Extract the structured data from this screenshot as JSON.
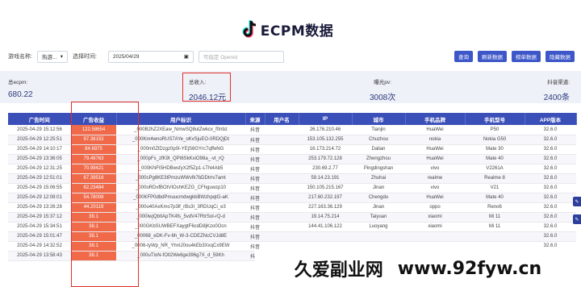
{
  "app": {
    "title": "ECPM数据"
  },
  "filters": {
    "game_label": "游戏名称:",
    "game_value": "热游...",
    "date_label": "选择时间:",
    "date_value": "2025/04/29",
    "openid_placeholder": "可指定 Openid"
  },
  "buttons": [
    "查询",
    "刷新数据",
    "榜单数据",
    "隐藏数据"
  ],
  "stats": [
    {
      "label": "总ecpm:",
      "value": "680.22"
    },
    {
      "label": "总收入:",
      "value": "2046.12元"
    },
    {
      "label": "曝光pv:",
      "value": "3008次"
    },
    {
      "label": "抖音渠道:",
      "value": "2400条"
    }
  ],
  "table": {
    "headers": [
      "广告时间",
      "广告收益",
      "用户标识",
      "来源",
      "用户名",
      "IP",
      "城市",
      "手机品牌",
      "手机型号",
      "APP版本"
    ],
    "rows": [
      [
        "2025-04-29 15:12:56",
        "122.58654",
        "_000B2hZ2XEaw_NmwSQ8utZwkcx_f0nbz",
        "抖音",
        "",
        "26.176.210.46",
        "Tianjin",
        "HuaWei",
        "P50",
        "32.6.0"
      ],
      [
        "2025-04-29 12:25:51",
        "97.38153",
        "_000Km4wnoRUS7AYe_oKvSjuEO-0RDQjDt",
        "抖音",
        "",
        "153.105.132.255",
        "Chuzhou",
        "nokia",
        "Nokia G50",
        "32.6.0"
      ],
      [
        "2025-04-29 14:10:17",
        "84.6975",
        "_000m0ZlDzgz0p0I-YEjS8GYrc7qffeNG",
        "抖音",
        "",
        "16.173.214.72",
        "Dalian",
        "HuaWei",
        "Mate 30",
        "32.6.0"
      ],
      [
        "2025-04-29 13:36:05",
        "79.49763",
        "_000pFs_zfK9I_QPt6SkKxiO98a_-vt_rQ",
        "抖音",
        "",
        "253.179.72.128",
        "Zhengzhou",
        "HuaWei",
        "Mate 40",
        "32.6.0"
      ],
      [
        "2025-04-29 12:31:25",
        "70.99421",
        "_000KNFt5HDBwsfyX2f5Zp1-LTN4Ab5",
        "抖音",
        "",
        "230.69.2.77",
        "Pingdingshan",
        "vivo",
        "V2261A",
        "32.6.0"
      ],
      [
        "2025-04-29 12:51:01",
        "67.39516",
        "_000cPg6KE3tPmzuWWvfk7bDDtrrv7amt",
        "抖音",
        "",
        "59.14.23.191",
        "Zhuhai",
        "realme",
        "Realme 8",
        "32.6.0"
      ],
      [
        "2025-04-29 15:06:55",
        "62.23484",
        "_000oRDvfBOtVIOshKEZG_CFhguwzp10",
        "抖音",
        "",
        "150.105.215.167",
        "Jinan",
        "vivo",
        "V21",
        "32.6.0"
      ],
      [
        "2025-04-29 12:08:01",
        "54.78008",
        "_000KFP0dbdPmuucmdwgkbBWzhpqtG-aK",
        "抖音",
        "",
        "217.60.232.197",
        "Chengdu",
        "HuaWei",
        "Mate 40",
        "32.6.0"
      ],
      [
        "2025-04-29 13:26:28",
        "44.20119",
        "_000o40AxKmo7p3lf_rBs3I_3RDUqCi_e3",
        "抖音",
        "",
        "227.163.36.129",
        "Jinan",
        "oppo",
        "Reno6",
        "32.6.0"
      ],
      [
        "2025-04-29 15:37:12",
        "38.1",
        "_000IwjQbtIApTK4fs_5vdV47RtrSot-rQ-d",
        "抖音",
        "",
        "19.14.75.214",
        "Taiyuan",
        "xiaomi",
        "Mi 11",
        "32.6.0"
      ],
      [
        "2025-04-29 15:34:51",
        "38.1",
        "_000GKbSUWBEFXaygtF6cdD8jKzo0Ocn",
        "抖音",
        "",
        "144.41.106.122",
        "Luoyang",
        "xiaomi",
        "Mi 11",
        "32.6.0"
      ],
      [
        "2025-04-29 15:01:47",
        "38.1",
        "_00068_eDK-Fv-6h_W-3-CDEZNcCVJd8E",
        "抖音",
        "",
        "",
        "",
        "",
        "",
        "32.6.0"
      ],
      [
        "2025-04-29 14:32:52",
        "38.1",
        "_0006-tyWp_NR_YhnIJ0ou4kEb3XxqCx9EW",
        "抖音",
        "",
        "",
        "",
        "",
        "",
        "32.6.0"
      ],
      [
        "2025-04-29 13:58:43",
        "38.1",
        "_000uTloN-fOlI2We6ge396g7X_d_59Kh",
        "抖音",
        "",
        "",
        "",
        "",
        "",
        "32.6.0"
      ]
    ]
  },
  "watermark": {
    "cn": "久爱副业网",
    "en": "www.92fyw.cn"
  },
  "colors": {
    "primary": "#3b4fb8",
    "highlight": "#f06a4a",
    "annotation": "#e0302a"
  }
}
